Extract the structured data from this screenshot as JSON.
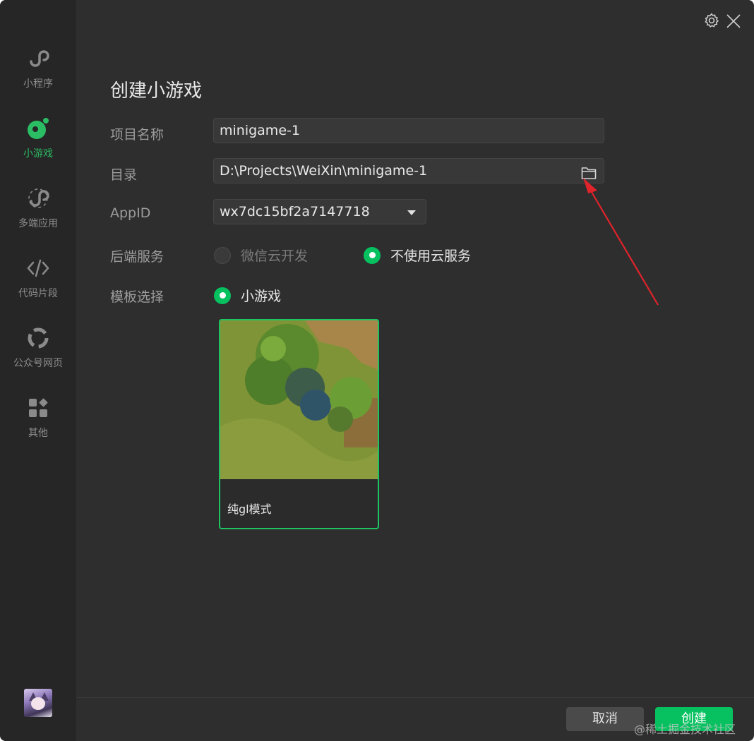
{
  "window": {
    "title": "创建小游戏"
  },
  "sidebar": {
    "items": [
      {
        "label": "小程序",
        "icon": "mini-program-icon",
        "active": false
      },
      {
        "label": "小游戏",
        "icon": "mini-game-icon",
        "active": true
      },
      {
        "label": "多端应用",
        "icon": "multi-platform-icon",
        "active": false
      },
      {
        "label": "代码片段",
        "icon": "code-icon",
        "active": false
      },
      {
        "label": "公众号网页",
        "icon": "official-account-icon",
        "active": false
      },
      {
        "label": "其他",
        "icon": "apps-grid-icon",
        "active": false
      }
    ],
    "avatar": "user-avatar"
  },
  "form": {
    "project_name": {
      "label": "项目名称",
      "value": "minigame-1"
    },
    "directory": {
      "label": "目录",
      "value": "D:\\Projects\\WeiXin\\minigame-1"
    },
    "appid": {
      "label": "AppID",
      "value": "wx7dc15bf2a7147718"
    },
    "backend": {
      "label": "后端服务",
      "options": [
        {
          "label": "微信云开发",
          "selected": false
        },
        {
          "label": "不使用云服务",
          "selected": true
        }
      ]
    },
    "template": {
      "label": "模板选择",
      "option": {
        "label": "小游戏",
        "selected": true
      },
      "card": {
        "label": "纯gl模式"
      }
    }
  },
  "footer": {
    "cancel_label": "取消",
    "create_label": "创建"
  },
  "watermark": "@稀土掘金技术社区",
  "colors": {
    "accent": "#07c160",
    "background": "#2e2e2e",
    "sidebar": "#262626",
    "arrow": "#e0242b"
  }
}
